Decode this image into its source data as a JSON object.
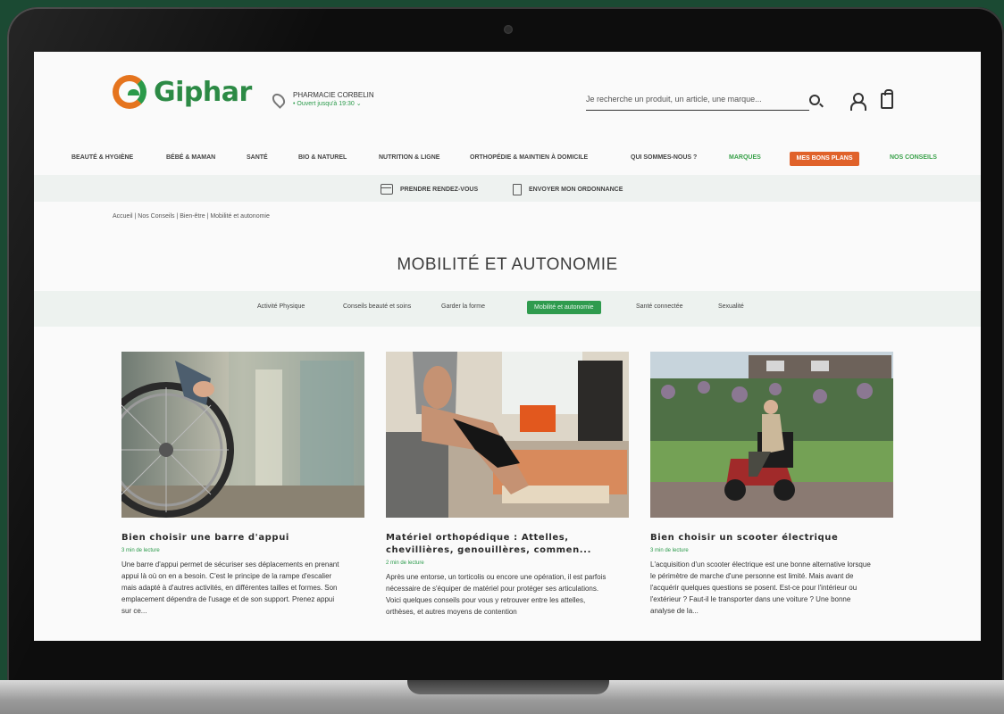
{
  "header": {
    "logo_text": "Giphar",
    "pharmacy_name": "PHARMACIE CORBELIN",
    "pharmacy_status": "• Ouvert jusqu'à 19:30 ⌄",
    "search_placeholder": "Je recherche un produit, un article, une marque..."
  },
  "nav": {
    "items": [
      "BEAUTÉ & HYGIÈNE",
      "BÉBÉ & MAMAN",
      "SANTÉ",
      "BIO & NATUREL",
      "NUTRITION & LIGNE",
      "ORTHOPÉDIE & MAINTIEN À DOMICILE",
      "QUI SOMMES-NOUS ?",
      "MARQUES"
    ],
    "deals_label": "MES BONS PLANS",
    "tips_label": "NOS CONSEILS"
  },
  "subnav": {
    "appointment": "PRENDRE RENDEZ-VOUS",
    "prescription": "ENVOYER MON ORDONNANCE"
  },
  "breadcrumb": "Accueil | Nos Conseils | Bien-être | Mobilité et autonomie",
  "page_title": "MOBILITÉ ET AUTONOMIE",
  "filters": [
    "Activité Physique",
    "Conseils beauté et soins",
    "Garder la forme",
    "Mobilité et autonomie",
    "Santé connectée",
    "Sexualité"
  ],
  "cards": [
    {
      "title": "Bien choisir une barre d'appui",
      "time": "3 min de lecture",
      "text": "Une barre d'appui permet de sécuriser ses déplacements en prenant appui là où on en a besoin. C'est le principe de la rampe d'escalier mais adapté à d'autres activités, en différentes tailles et formes. Son emplacement dépendra de l'usage et de son support. Prenez appui sur ce..."
    },
    {
      "title": "Matériel orthopédique : Attelles, chevillières, genouillères, commen...",
      "time": "2 min de lecture",
      "text": "Après une entorse, un torticolis ou encore une opération, il est parfois nécessaire de s'équiper de matériel pour protéger ses articulations. Voici quelques conseils pour vous y retrouver entre les attelles, orthèses, et autres moyens de contention"
    },
    {
      "title": "Bien choisir un scooter électrique",
      "time": "3 min de lecture",
      "text": "L'acquisition d'un scooter électrique est une bonne alternative lorsque le périmètre de marche d'une personne est limité. Mais avant de l'acquérir quelques questions se posent. Est-ce pour l'intérieur ou l'extérieur ? Faut-il le transporter dans une voiture ? Une bonne analyse de la..."
    }
  ],
  "colors": {
    "brand_green": "#2c8a45",
    "brand_orange": "#e5741e",
    "deals_button": "#e0622a",
    "active_filter": "#2f9b4e"
  }
}
